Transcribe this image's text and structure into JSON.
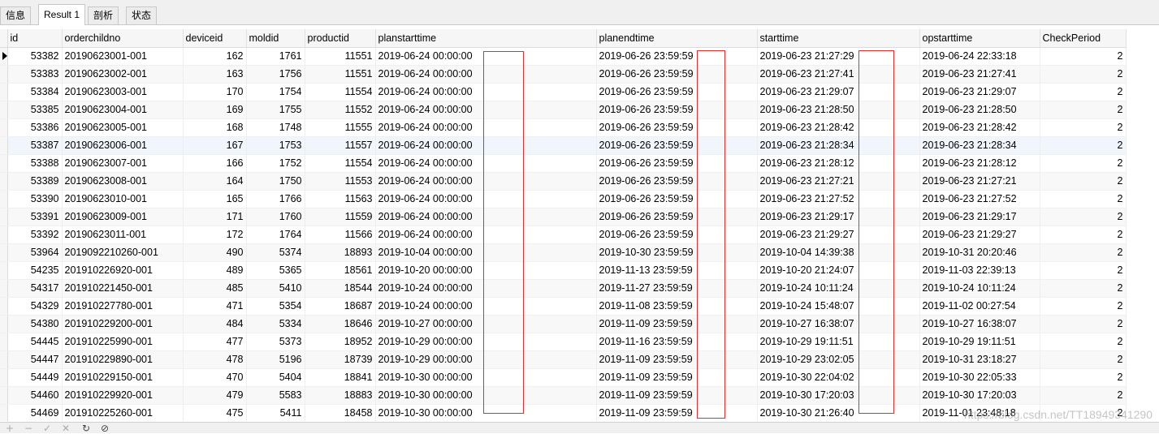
{
  "tabs": [
    "信息",
    "Result 1",
    "剖析",
    "状态"
  ],
  "columns": [
    "id",
    "orderchildno",
    "deviceid",
    "moldid",
    "productid",
    "planstarttime",
    "planendtime",
    "starttime",
    "opstarttime",
    "CheckPeriod"
  ],
  "rows": [
    [
      "53382",
      "20190623001-001",
      "162",
      "1761",
      "11551",
      "2019-06-24 00:00:00",
      "2019-06-26 23:59:59",
      "2019-06-23 21:27:29",
      "2019-06-24 22:33:18",
      "2"
    ],
    [
      "53383",
      "20190623002-001",
      "163",
      "1756",
      "11551",
      "2019-06-24 00:00:00",
      "2019-06-26 23:59:59",
      "2019-06-23 21:27:41",
      "2019-06-23 21:27:41",
      "2"
    ],
    [
      "53384",
      "20190623003-001",
      "170",
      "1754",
      "11554",
      "2019-06-24 00:00:00",
      "2019-06-26 23:59:59",
      "2019-06-23 21:29:07",
      "2019-06-23 21:29:07",
      "2"
    ],
    [
      "53385",
      "20190623004-001",
      "169",
      "1755",
      "11552",
      "2019-06-24 00:00:00",
      "2019-06-26 23:59:59",
      "2019-06-23 21:28:50",
      "2019-06-23 21:28:50",
      "2"
    ],
    [
      "53386",
      "20190623005-001",
      "168",
      "1748",
      "11555",
      "2019-06-24 00:00:00",
      "2019-06-26 23:59:59",
      "2019-06-23 21:28:42",
      "2019-06-23 21:28:42",
      "2"
    ],
    [
      "53387",
      "20190623006-001",
      "167",
      "1753",
      "11557",
      "2019-06-24 00:00:00",
      "2019-06-26 23:59:59",
      "2019-06-23 21:28:34",
      "2019-06-23 21:28:34",
      "2"
    ],
    [
      "53388",
      "20190623007-001",
      "166",
      "1752",
      "11554",
      "2019-06-24 00:00:00",
      "2019-06-26 23:59:59",
      "2019-06-23 21:28:12",
      "2019-06-23 21:28:12",
      "2"
    ],
    [
      "53389",
      "20190623008-001",
      "164",
      "1750",
      "11553",
      "2019-06-24 00:00:00",
      "2019-06-26 23:59:59",
      "2019-06-23 21:27:21",
      "2019-06-23 21:27:21",
      "2"
    ],
    [
      "53390",
      "20190623010-001",
      "165",
      "1766",
      "11563",
      "2019-06-24 00:00:00",
      "2019-06-26 23:59:59",
      "2019-06-23 21:27:52",
      "2019-06-23 21:27:52",
      "2"
    ],
    [
      "53391",
      "20190623009-001",
      "171",
      "1760",
      "11559",
      "2019-06-24 00:00:00",
      "2019-06-26 23:59:59",
      "2019-06-23 21:29:17",
      "2019-06-23 21:29:17",
      "2"
    ],
    [
      "53392",
      "20190623011-001",
      "172",
      "1764",
      "11566",
      "2019-06-24 00:00:00",
      "2019-06-26 23:59:59",
      "2019-06-23 21:29:27",
      "2019-06-23 21:29:27",
      "2"
    ],
    [
      "53964",
      "2019092210260-001",
      "490",
      "5374",
      "18893",
      "2019-10-04 00:00:00",
      "2019-10-30 23:59:59",
      "2019-10-04 14:39:38",
      "2019-10-31 20:20:46",
      "2"
    ],
    [
      "54235",
      "201910226920-001",
      "489",
      "5365",
      "18561",
      "2019-10-20 00:00:00",
      "2019-11-13 23:59:59",
      "2019-10-20 21:24:07",
      "2019-11-03 22:39:13",
      "2"
    ],
    [
      "54317",
      "201910221450-001",
      "485",
      "5410",
      "18544",
      "2019-10-24 00:00:00",
      "2019-11-27 23:59:59",
      "2019-10-24 10:11:24",
      "2019-10-24 10:11:24",
      "2"
    ],
    [
      "54329",
      "201910227780-001",
      "471",
      "5354",
      "18687",
      "2019-10-24 00:00:00",
      "2019-11-08 23:59:59",
      "2019-10-24 15:48:07",
      "2019-11-02 00:27:54",
      "2"
    ],
    [
      "54380",
      "201910229200-001",
      "484",
      "5334",
      "18646",
      "2019-10-27 00:00:00",
      "2019-11-09 23:59:59",
      "2019-10-27 16:38:07",
      "2019-10-27 16:38:07",
      "2"
    ],
    [
      "54445",
      "201910225990-001",
      "477",
      "5373",
      "18952",
      "2019-10-29 00:00:00",
      "2019-11-16 23:59:59",
      "2019-10-29 19:11:51",
      "2019-10-29 19:11:51",
      "2"
    ],
    [
      "54447",
      "201910229890-001",
      "478",
      "5196",
      "18739",
      "2019-10-29 00:00:00",
      "2019-11-09 23:59:59",
      "2019-10-29 23:02:05",
      "2019-10-31 23:18:27",
      "2"
    ],
    [
      "54449",
      "201910229150-001",
      "470",
      "5404",
      "18841",
      "2019-10-30 00:00:00",
      "2019-11-09 23:59:59",
      "2019-10-30 22:04:02",
      "2019-10-30 22:05:33",
      "2"
    ],
    [
      "54460",
      "201910229920-001",
      "479",
      "5583",
      "18883",
      "2019-10-30 00:00:00",
      "2019-11-09 23:59:59",
      "2019-10-30 17:20:03",
      "2019-10-30 17:20:03",
      "2"
    ],
    [
      "54469",
      "201910225260-001",
      "475",
      "5411",
      "18458",
      "2019-10-30 00:00:00",
      "2019-11-09 23:59:59",
      "2019-10-30 21:26:40",
      "2019-11-01 23:48:18",
      "2"
    ]
  ],
  "status_icons": [
    "plus-icon",
    "minus-icon",
    "check-icon",
    "close-icon",
    "refresh-icon",
    "stop-icon"
  ],
  "watermark": "https://blog.csdn.net/TT18949341290",
  "colors": {
    "highlight_box": "#d83232",
    "selected_row": "#f1f6fc"
  }
}
